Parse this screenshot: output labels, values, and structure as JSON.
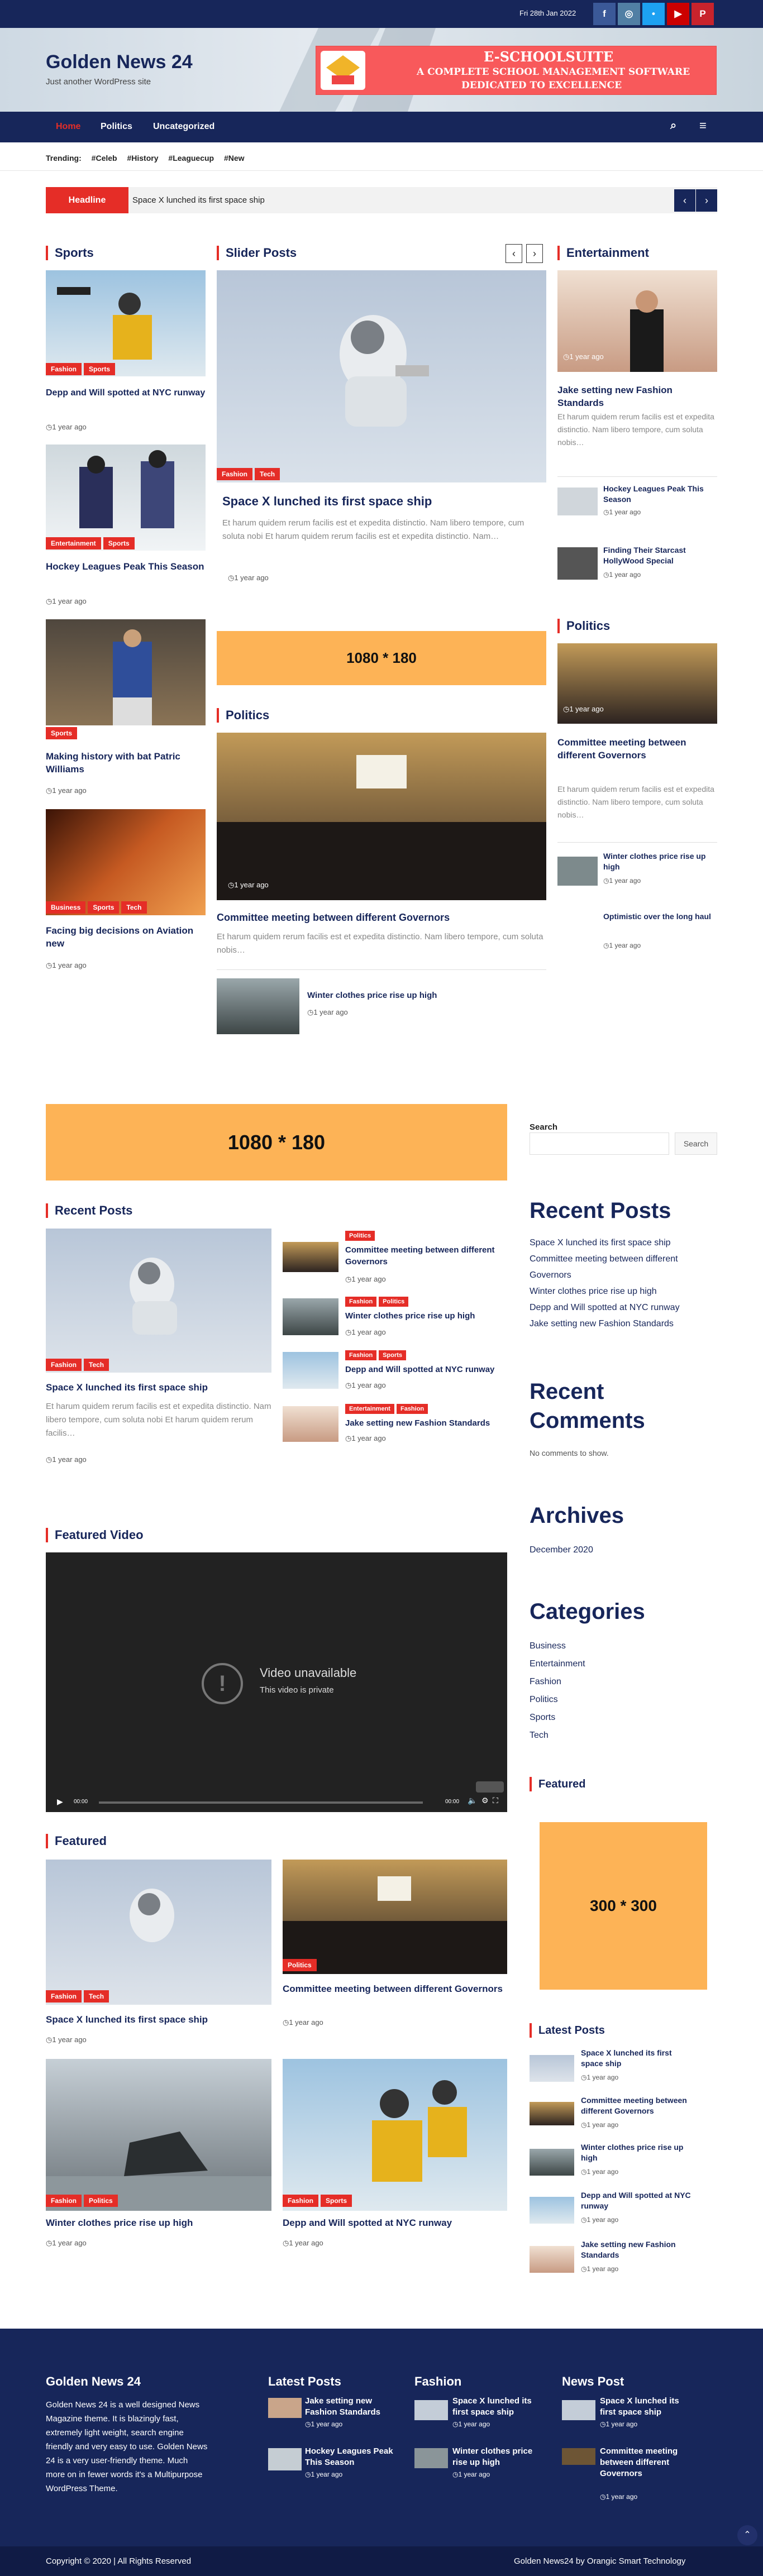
{
  "topbar": {
    "date": "Fri 28th Jan 2022",
    "social": [
      "f",
      "◎",
      "•",
      "▶",
      "P"
    ]
  },
  "site": {
    "title": "Golden News 24",
    "tagline": "Just another WordPress site"
  },
  "banner": {
    "t1": "E-SCHOOLSUITE",
    "t2": "A COMPLETE SCHOOL MANAGEMENT SOFTWARE",
    "t3": "DEDICATED TO EXCELLENCE"
  },
  "nav": {
    "items": [
      "Home",
      "Politics",
      "Uncategorized"
    ],
    "search_icon": "⌕",
    "menu_icon": "≡"
  },
  "trending": {
    "label": "Trending:",
    "tags": [
      "#Celeb",
      "#History",
      "#Leaguecup",
      "#New"
    ]
  },
  "headline": {
    "label": "Headline",
    "text": "Space X lunched its first space ship"
  },
  "sports": {
    "title": "Sports",
    "posts": [
      {
        "title": "Depp and Will spotted at NYC runway",
        "tags": [
          "Fashion",
          "Sports"
        ],
        "date": "1 year ago"
      },
      {
        "title": "Hockey Leagues Peak This Season",
        "tags": [
          "Entertainment",
          "Sports"
        ],
        "date": "1 year ago"
      },
      {
        "title": "Making history with bat Patric Williams",
        "tags": [
          "Sports"
        ],
        "date": "1 year ago"
      },
      {
        "title": "Facing big decisions on Aviation new",
        "tags": [
          "Business",
          "Sports",
          "Tech"
        ],
        "date": "1 year ago"
      }
    ]
  },
  "slider": {
    "title": "Slider Posts",
    "post": {
      "title": "Space X lunched its first space ship",
      "tags": [
        "Fashion",
        "Tech"
      ],
      "excerpt": "Et harum quidem rerum facilis est et expedita distinctio. Nam libero tempore, cum soluta nobi Et harum quidem rerum facilis est et expedita distinctio. Nam…",
      "date": "1 year ago"
    }
  },
  "ad1": "1080 * 180",
  "politics": {
    "title": "Politics",
    "main": {
      "title": "Committee meeting between different Governors",
      "date": "1 year ago",
      "excerpt": "Et harum quidem rerum facilis est et expedita distinctio. Nam libero tempore, cum soluta nobis…"
    },
    "small": {
      "title": "Winter clothes price rise up high",
      "date": "1 year ago"
    }
  },
  "entertainment": {
    "title": "Entertainment",
    "main": {
      "title": "Jake setting new Fashion Standards",
      "date": "1 year ago",
      "excerpt": "Et harum quidem rerum facilis est et expedita distinctio. Nam libero tempore, cum soluta nobis…"
    },
    "list": [
      {
        "title": "Hockey Leagues Peak This Season",
        "date": "1 year ago"
      },
      {
        "title": "Finding Their Starcast HollyWood Special",
        "date": "1 year ago"
      }
    ]
  },
  "politics_side": {
    "title": "Politics",
    "main": {
      "title": "Committee meeting between different Governors",
      "date": "1 year ago",
      "excerpt": "Et harum quidem rerum facilis est et expedita distinctio. Nam libero tempore, cum soluta nobis…"
    },
    "list": [
      {
        "title": "Winter clothes price rise up high",
        "date": "1 year ago"
      },
      {
        "title": "Optimistic over the long haul",
        "date": "1 year ago"
      }
    ]
  },
  "ad2": "1080 * 180",
  "recent": {
    "title": "Recent Posts",
    "main": {
      "title": "Space X lunched its first space ship",
      "tags": [
        "Fashion",
        "Tech"
      ],
      "excerpt": "Et harum quidem rerum facilis est et expedita distinctio. Nam libero tempore, cum soluta nobi Et harum quidem rerum facilis…",
      "date": "1 year ago"
    },
    "list": [
      {
        "title": "Committee meeting between different Governors",
        "tags": [
          "Politics"
        ],
        "date": "1 year ago"
      },
      {
        "title": "Winter clothes price rise up high",
        "tags": [
          "Fashion",
          "Politics"
        ],
        "date": "1 year ago"
      },
      {
        "title": "Depp and Will spotted at NYC runway",
        "tags": [
          "Fashion",
          "Sports"
        ],
        "date": "1 year ago"
      },
      {
        "title": "Jake setting new Fashion Standards",
        "tags": [
          "Entertainment",
          "Fashion"
        ],
        "date": "1 year ago"
      }
    ]
  },
  "video": {
    "title": "Featured Video",
    "unavailable": "Video unavailable",
    "private": "This video is private",
    "time_start": "00:00",
    "time_end": "00:00"
  },
  "featured": {
    "title": "Featured",
    "posts": [
      {
        "title": "Space X lunched its first space ship",
        "tags": [
          "Fashion",
          "Tech"
        ],
        "date": "1 year ago"
      },
      {
        "title": "Committee meeting between different Governors",
        "tags": [
          "Politics"
        ],
        "date": "1 year ago"
      },
      {
        "title": "Winter clothes price rise up high",
        "tags": [
          "Fashion",
          "Politics"
        ],
        "date": "1 year ago"
      },
      {
        "title": "Depp and Will spotted at NYC runway",
        "tags": [
          "Fashion",
          "Sports"
        ],
        "date": "1 year ago"
      }
    ]
  },
  "sidebar": {
    "search_label": "Search",
    "search_button": "Search",
    "recent_title": "Recent Posts",
    "recent": [
      "Space X lunched its first space ship",
      "Committee meeting between different Governors",
      "Winter clothes price rise up high",
      "Depp and Will spotted at NYC runway",
      "Jake setting new Fashion Standards"
    ],
    "comments_title": "Recent Comments",
    "comments_empty": "No comments to show.",
    "archives_title": "Archives",
    "archives": [
      "December 2020"
    ],
    "categories_title": "Categories",
    "categories": [
      "Business",
      "Entertainment",
      "Fashion",
      "Politics",
      "Sports",
      "Tech"
    ],
    "featured_title": "Featured",
    "ad": "300 * 300",
    "latest_title": "Latest Posts",
    "latest": [
      {
        "title": "Space X lunched its first space ship",
        "date": "1 year ago"
      },
      {
        "title": "Committee meeting between different Governors",
        "date": "1 year ago"
      },
      {
        "title": "Winter clothes price rise up high",
        "date": "1 year ago"
      },
      {
        "title": "Depp and Will spotted at NYC runway",
        "date": "1 year ago"
      },
      {
        "title": "Jake setting new Fashion Standards",
        "date": "1 year ago"
      }
    ]
  },
  "footer": {
    "about_title": "Golden News 24",
    "about_text": "Golden News 24 is a well designed News Magazine theme. It is blazingly fast, extremely light weight, search engine friendly and very easy to use. Golden News 24 is a very user-friendly theme. Much more on in fewer words it's a Multipurpose WordPress Theme.",
    "latest_title": "Latest Posts",
    "latest": [
      {
        "title": "Jake setting new Fashion Standards",
        "date": "1 year ago"
      },
      {
        "title": "Hockey Leagues Peak This Season",
        "date": "1 year ago"
      }
    ],
    "fashion_title": "Fashion",
    "fashion": [
      {
        "title": "Space X lunched its first space ship",
        "date": "1 year ago"
      },
      {
        "title": "Winter clothes price rise up high",
        "date": "1 year ago"
      }
    ],
    "news_title": "News Post",
    "news": [
      {
        "title": "Space X lunched its first space ship",
        "date": "1 year ago"
      },
      {
        "title": "Committee meeting between different Governors",
        "date": "1 year ago"
      }
    ],
    "copyright": "Copyright © 2020 | All Rights Reserved",
    "credit": "Golden News24 by Orangic Smart Technology"
  },
  "colors": {
    "navy": "#17265a",
    "red": "#e52d27",
    "ad": "#fdb356"
  }
}
